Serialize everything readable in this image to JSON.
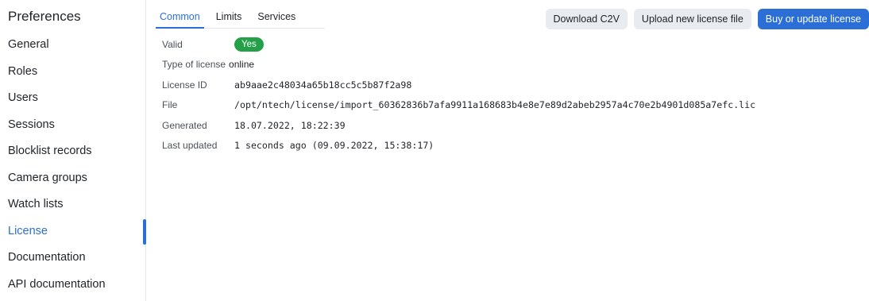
{
  "sidebar": {
    "title": "Preferences",
    "items": [
      {
        "label": "General"
      },
      {
        "label": "Roles"
      },
      {
        "label": "Users"
      },
      {
        "label": "Sessions"
      },
      {
        "label": "Blocklist records"
      },
      {
        "label": "Camera groups"
      },
      {
        "label": "Watch lists"
      },
      {
        "label": "License",
        "active": true
      },
      {
        "label": "Documentation"
      },
      {
        "label": "API documentation"
      }
    ]
  },
  "tabs": [
    {
      "label": "Common",
      "active": true
    },
    {
      "label": "Limits"
    },
    {
      "label": "Services"
    }
  ],
  "actions": {
    "download": "Download C2V",
    "upload": "Upload new license file",
    "buy": "Buy or update license"
  },
  "license": {
    "valid_label": "Valid",
    "valid_value": "Yes",
    "type_label": "Type of license",
    "type_value": "online",
    "id_label": "License ID",
    "id_value": "ab9aae2c48034a65b18cc5c5b87f2a98",
    "file_label": "File",
    "file_value": "/opt/ntech/license/import_60362836b7afa9911a168683b4e8e7e89d2abeb2957a4c70e2b4901d085a7efc.lic",
    "generated_label": "Generated",
    "generated_value": "18.07.2022, 18:22:39",
    "updated_label": "Last updated",
    "updated_value": "1 seconds ago (09.09.2022, 15:38:17)"
  },
  "colors": {
    "accent": "#2b6fd6",
    "success": "#24a148",
    "button_bg": "#e8ebef"
  }
}
